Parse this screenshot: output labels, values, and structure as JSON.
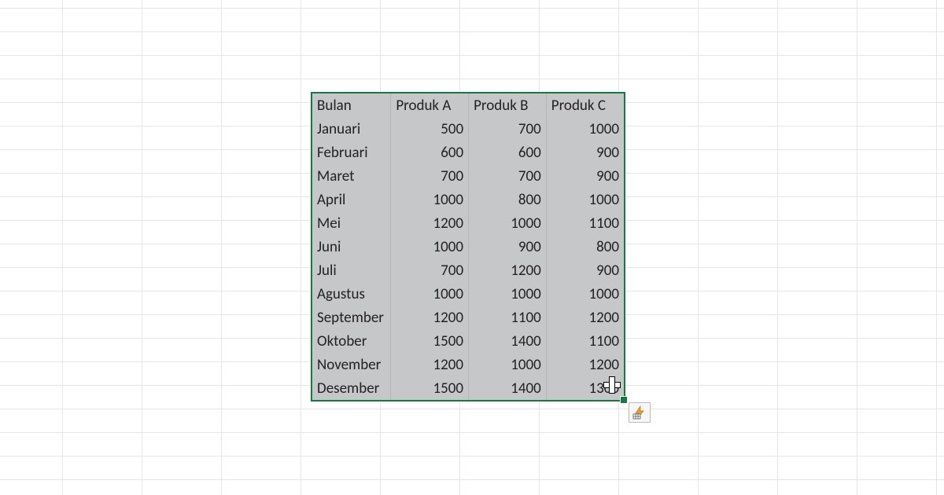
{
  "table": {
    "headers": [
      "Bulan",
      "Produk A",
      "Produk B",
      "Produk C"
    ],
    "rows": [
      {
        "bulan": "Januari",
        "a": 500,
        "b": 700,
        "c": 1000
      },
      {
        "bulan": "Februari",
        "a": 600,
        "b": 600,
        "c": 900
      },
      {
        "bulan": "Maret",
        "a": 700,
        "b": 700,
        "c": 900
      },
      {
        "bulan": "April",
        "a": 1000,
        "b": 800,
        "c": 1000
      },
      {
        "bulan": "Mei",
        "a": 1200,
        "b": 1000,
        "c": 1100
      },
      {
        "bulan": "Juni",
        "a": 1000,
        "b": 900,
        "c": 800
      },
      {
        "bulan": "Juli",
        "a": 700,
        "b": 1200,
        "c": 900
      },
      {
        "bulan": "Agustus",
        "a": 1000,
        "b": 1000,
        "c": 1000
      },
      {
        "bulan": "September",
        "a": 1200,
        "b": 1100,
        "c": 1200
      },
      {
        "bulan": "Oktober",
        "a": 1500,
        "b": 1400,
        "c": 1100
      },
      {
        "bulan": "November",
        "a": 1200,
        "b": 1000,
        "c": 1200
      },
      {
        "bulan": "Desember",
        "a": 1500,
        "b": 1400,
        "c": 1300
      }
    ]
  },
  "icons": {
    "quick_analysis": "quick-analysis-icon",
    "cell_cursor": "cell-cursor-icon"
  },
  "colors": {
    "selection_border": "#107c41",
    "selection_fill": "#c6c7c8",
    "gridline": "#e6e6e6"
  }
}
